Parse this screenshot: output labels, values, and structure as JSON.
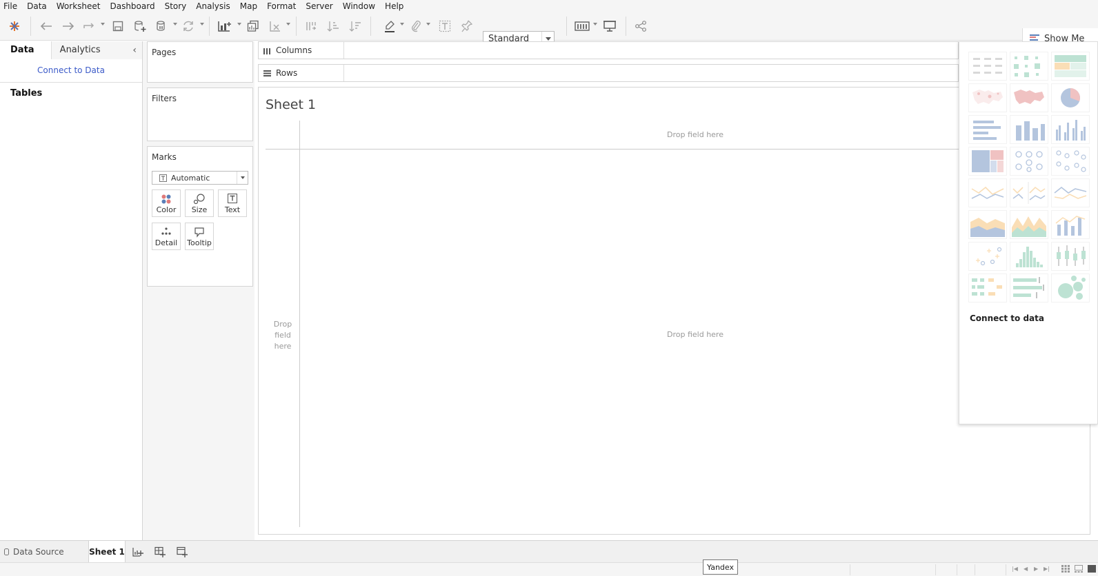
{
  "menu": [
    "File",
    "Data",
    "Worksheet",
    "Dashboard",
    "Story",
    "Analysis",
    "Map",
    "Format",
    "Server",
    "Window",
    "Help"
  ],
  "toolbar": {
    "fit_select": "Standard",
    "show_me": "Show Me"
  },
  "left_pane": {
    "tab_data": "Data",
    "tab_analytics": "Analytics",
    "connect_link": "Connect to Data",
    "tables_heading": "Tables"
  },
  "cards": {
    "pages": "Pages",
    "filters": "Filters",
    "marks": "Marks",
    "mark_type": "Automatic",
    "mark_buttons": [
      "Color",
      "Size",
      "Text",
      "Detail",
      "Tooltip"
    ]
  },
  "shelves": {
    "columns": "Columns",
    "rows": "Rows"
  },
  "canvas": {
    "sheet_title": "Sheet 1",
    "col_drop": "Drop field here",
    "row_drop_lines": [
      "Drop",
      "field",
      "here"
    ],
    "main_drop": "Drop field here"
  },
  "show_me_panel": {
    "message": "Connect to data"
  },
  "bottom": {
    "data_source": "Data Source",
    "sheet_tab": "Sheet 1"
  },
  "status": {
    "tooltip": "Yandex"
  },
  "colors": {
    "link": "#3b5ac8",
    "accent_blue": "#5a7fb8",
    "green": "#6fc0a0",
    "orange": "#f4b860",
    "red": "#e07a7a"
  }
}
